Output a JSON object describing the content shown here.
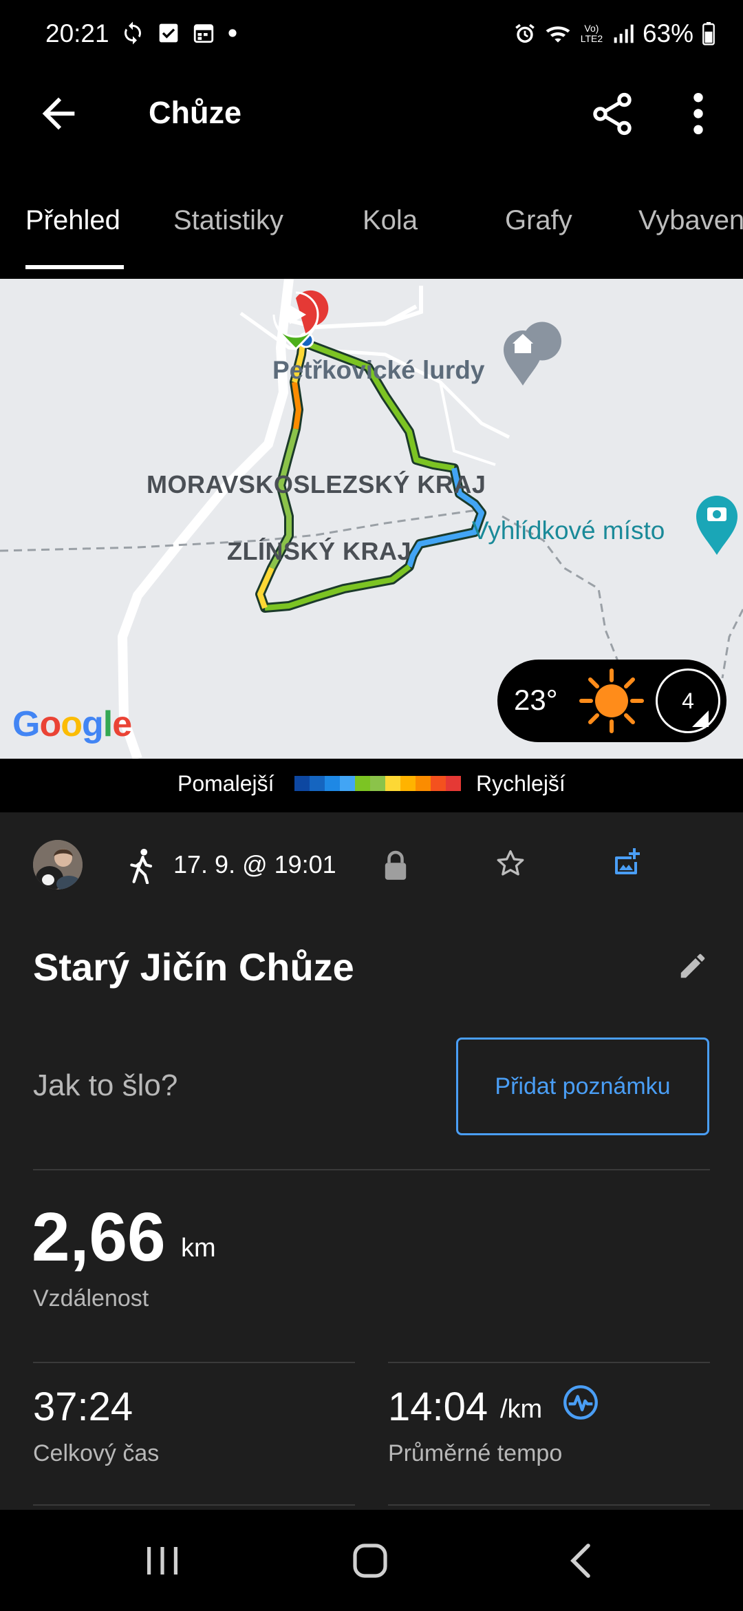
{
  "status_bar": {
    "time": "20:21",
    "battery": "63%",
    "network": "Vo) LTE2"
  },
  "app_bar": {
    "title": "Chůze"
  },
  "tabs": [
    {
      "label": "Přehled",
      "active": true
    },
    {
      "label": "Statistiky",
      "active": false
    },
    {
      "label": "Kola",
      "active": false
    },
    {
      "label": "Grafy",
      "active": false
    },
    {
      "label": "Vybaven",
      "active": false
    }
  ],
  "map": {
    "labels": {
      "region_1": "MORAVSKOSLEZSKÝ KRAJ",
      "region_2": "ZLÍNSKÝ KRAJ",
      "poi_1": "Petřkovické lurdy",
      "poi_2": "Vyhlídkové místo"
    },
    "weather": {
      "temperature": "23°",
      "wind": "4",
      "icon": "sun-icon"
    },
    "attribution": "Google"
  },
  "legend": {
    "slower": "Pomalejší",
    "faster": "Rychlejší",
    "colors": [
      "#0d47a1",
      "#1565c0",
      "#1e88e5",
      "#42a5f5",
      "#7cc423",
      "#8bc34a",
      "#fdd835",
      "#ffb300",
      "#fb8c00",
      "#f4511e",
      "#e53935"
    ]
  },
  "activity": {
    "date": "17. 9. @ 19:01",
    "name": "Starý Jičín Chůze",
    "note_prompt": "Jak to šlo?",
    "add_note_label": "Přidat poznámku"
  },
  "stats": {
    "distance_value": "2,66",
    "distance_unit": "km",
    "distance_label": "Vzdálenost",
    "total_time_value": "37:24",
    "total_time_label": "Celkový čas",
    "avg_pace_value": "14:04",
    "avg_pace_unit": "/km",
    "avg_pace_label": "Průměrné tempo"
  },
  "colors": {
    "accent": "#4a9ef5",
    "background": "#1e1e1e",
    "route_green": "#7cc423"
  }
}
